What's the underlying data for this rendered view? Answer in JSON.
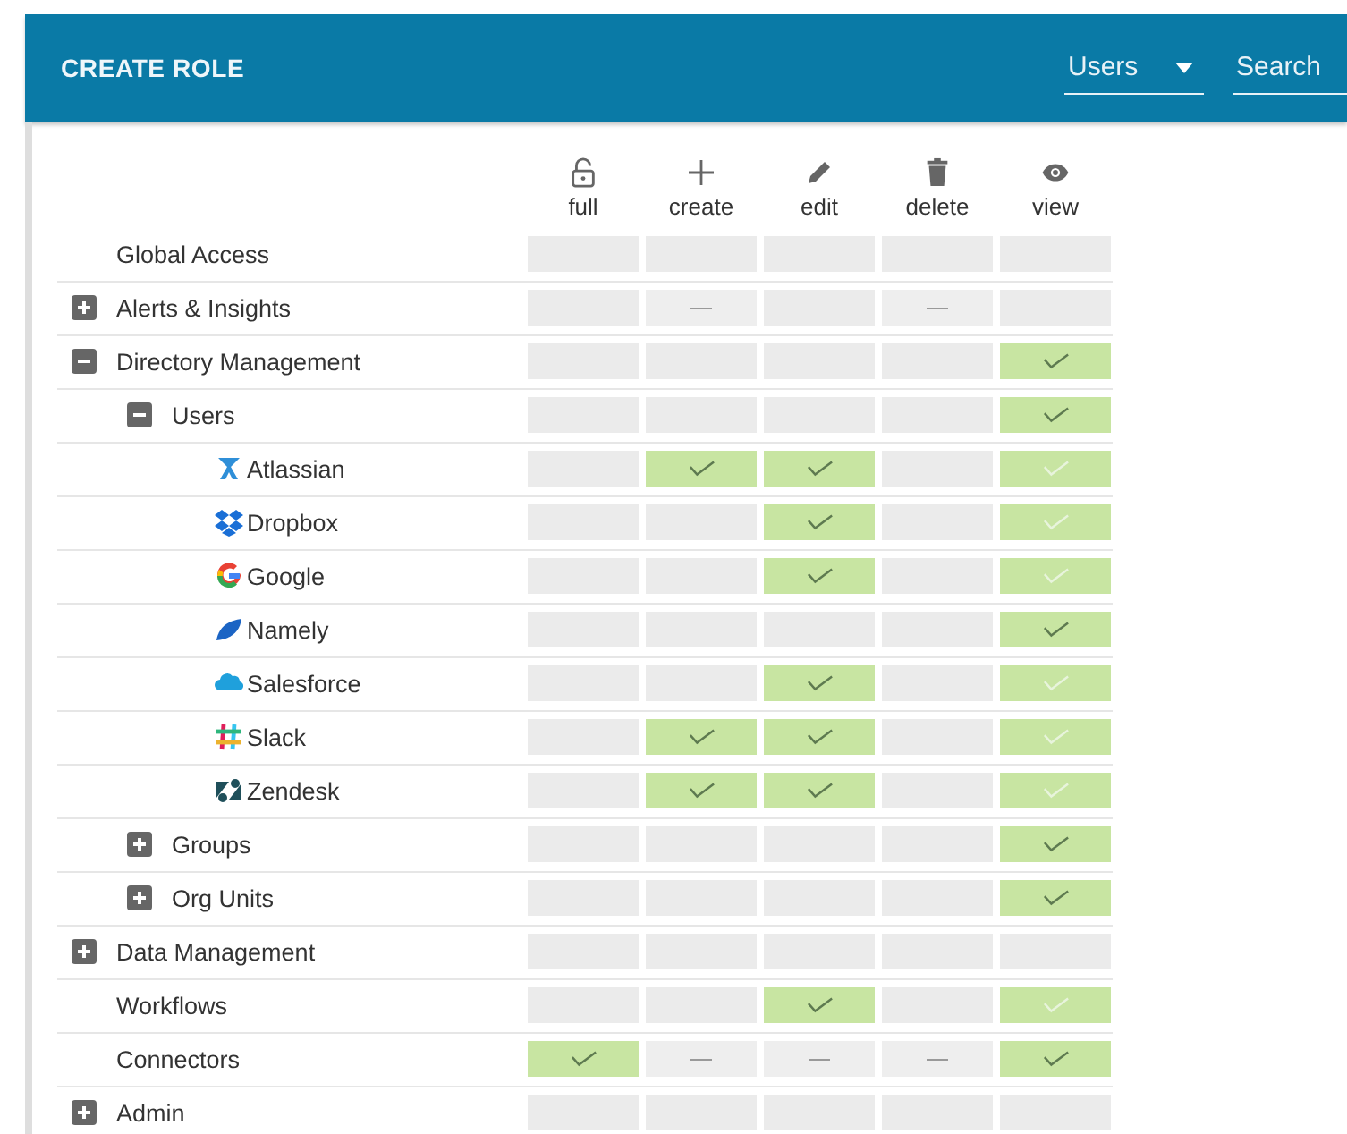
{
  "header": {
    "title": "CREATE ROLE",
    "filter": {
      "value": "Users"
    },
    "search": {
      "placeholder": "Search"
    }
  },
  "columns": [
    {
      "label": "full"
    },
    {
      "label": "create"
    },
    {
      "label": "edit"
    },
    {
      "label": "delete"
    },
    {
      "label": "view"
    }
  ],
  "rows": [
    {
      "label": "Global Access",
      "permissions": [
        {
          "checked": false,
          "inherited": false,
          "disabled": false
        },
        {
          "checked": false,
          "inherited": false,
          "disabled": false
        },
        {
          "checked": false,
          "inherited": false,
          "disabled": false
        },
        {
          "checked": false,
          "inherited": false,
          "disabled": false
        },
        {
          "checked": false,
          "inherited": false,
          "disabled": false
        }
      ]
    },
    {
      "label": "Alerts & Insights",
      "expanded": false,
      "permissions": [
        {
          "checked": false,
          "inherited": false,
          "disabled": false
        },
        {
          "checked": false,
          "inherited": false,
          "disabled": true
        },
        {
          "checked": false,
          "inherited": false,
          "disabled": false
        },
        {
          "checked": false,
          "inherited": false,
          "disabled": true
        },
        {
          "checked": false,
          "inherited": false,
          "disabled": false
        }
      ]
    },
    {
      "label": "Directory Management",
      "expanded": true,
      "permissions": [
        {
          "checked": false,
          "inherited": false,
          "disabled": false
        },
        {
          "checked": false,
          "inherited": false,
          "disabled": false
        },
        {
          "checked": false,
          "inherited": false,
          "disabled": false
        },
        {
          "checked": false,
          "inherited": false,
          "disabled": false
        },
        {
          "checked": true,
          "inherited": false,
          "disabled": false
        }
      ],
      "children": [
        {
          "label": "Users",
          "expanded": true,
          "permissions": [
            {
              "checked": false,
              "inherited": false,
              "disabled": false
            },
            {
              "checked": false,
              "inherited": false,
              "disabled": false
            },
            {
              "checked": false,
              "inherited": false,
              "disabled": false
            },
            {
              "checked": false,
              "inherited": false,
              "disabled": false
            },
            {
              "checked": true,
              "inherited": false,
              "disabled": false
            }
          ],
          "children": [
            {
              "label": "Atlassian",
              "kind": "app",
              "permissions": [
                {
                  "checked": false,
                  "inherited": false,
                  "disabled": false
                },
                {
                  "checked": true,
                  "inherited": false,
                  "disabled": false
                },
                {
                  "checked": true,
                  "inherited": false,
                  "disabled": false
                },
                {
                  "checked": false,
                  "inherited": false,
                  "disabled": false
                },
                {
                  "checked": true,
                  "inherited": true,
                  "disabled": false
                }
              ]
            },
            {
              "label": "Dropbox",
              "kind": "app",
              "permissions": [
                {
                  "checked": false,
                  "inherited": false,
                  "disabled": false
                },
                {
                  "checked": false,
                  "inherited": false,
                  "disabled": false
                },
                {
                  "checked": true,
                  "inherited": false,
                  "disabled": false
                },
                {
                  "checked": false,
                  "inherited": false,
                  "disabled": false
                },
                {
                  "checked": true,
                  "inherited": true,
                  "disabled": false
                }
              ]
            },
            {
              "label": "Google",
              "kind": "app",
              "permissions": [
                {
                  "checked": false,
                  "inherited": false,
                  "disabled": false
                },
                {
                  "checked": false,
                  "inherited": false,
                  "disabled": false
                },
                {
                  "checked": true,
                  "inherited": false,
                  "disabled": false
                },
                {
                  "checked": false,
                  "inherited": false,
                  "disabled": false
                },
                {
                  "checked": true,
                  "inherited": true,
                  "disabled": false
                }
              ]
            },
            {
              "label": "Namely",
              "kind": "app",
              "permissions": [
                {
                  "checked": false,
                  "inherited": false,
                  "disabled": false
                },
                {
                  "checked": false,
                  "inherited": false,
                  "disabled": false
                },
                {
                  "checked": false,
                  "inherited": false,
                  "disabled": false
                },
                {
                  "checked": false,
                  "inherited": false,
                  "disabled": false
                },
                {
                  "checked": true,
                  "inherited": false,
                  "disabled": false
                }
              ]
            },
            {
              "label": "Salesforce",
              "kind": "app",
              "permissions": [
                {
                  "checked": false,
                  "inherited": false,
                  "disabled": false
                },
                {
                  "checked": false,
                  "inherited": false,
                  "disabled": false
                },
                {
                  "checked": true,
                  "inherited": false,
                  "disabled": false
                },
                {
                  "checked": false,
                  "inherited": false,
                  "disabled": false
                },
                {
                  "checked": true,
                  "inherited": true,
                  "disabled": false
                }
              ]
            },
            {
              "label": "Slack",
              "kind": "app",
              "permissions": [
                {
                  "checked": false,
                  "inherited": false,
                  "disabled": false
                },
                {
                  "checked": true,
                  "inherited": false,
                  "disabled": false
                },
                {
                  "checked": true,
                  "inherited": false,
                  "disabled": false
                },
                {
                  "checked": false,
                  "inherited": false,
                  "disabled": false
                },
                {
                  "checked": true,
                  "inherited": true,
                  "disabled": false
                }
              ]
            },
            {
              "label": "Zendesk",
              "kind": "app",
              "permissions": [
                {
                  "checked": false,
                  "inherited": false,
                  "disabled": false
                },
                {
                  "checked": true,
                  "inherited": false,
                  "disabled": false
                },
                {
                  "checked": true,
                  "inherited": false,
                  "disabled": false
                },
                {
                  "checked": false,
                  "inherited": false,
                  "disabled": false
                },
                {
                  "checked": true,
                  "inherited": true,
                  "disabled": false
                }
              ]
            }
          ]
        },
        {
          "label": "Groups",
          "expanded": false,
          "permissions": [
            {
              "checked": false,
              "inherited": false,
              "disabled": false
            },
            {
              "checked": false,
              "inherited": false,
              "disabled": false
            },
            {
              "checked": false,
              "inherited": false,
              "disabled": false
            },
            {
              "checked": false,
              "inherited": false,
              "disabled": false
            },
            {
              "checked": true,
              "inherited": false,
              "disabled": false
            }
          ]
        },
        {
          "label": "Org Units",
          "expanded": false,
          "permissions": [
            {
              "checked": false,
              "inherited": false,
              "disabled": false
            },
            {
              "checked": false,
              "inherited": false,
              "disabled": false
            },
            {
              "checked": false,
              "inherited": false,
              "disabled": false
            },
            {
              "checked": false,
              "inherited": false,
              "disabled": false
            },
            {
              "checked": true,
              "inherited": false,
              "disabled": false
            }
          ]
        }
      ]
    },
    {
      "label": "Data Management",
      "expanded": false,
      "permissions": [
        {
          "checked": false,
          "inherited": false,
          "disabled": false
        },
        {
          "checked": false,
          "inherited": false,
          "disabled": false
        },
        {
          "checked": false,
          "inherited": false,
          "disabled": false
        },
        {
          "checked": false,
          "inherited": false,
          "disabled": false
        },
        {
          "checked": false,
          "inherited": false,
          "disabled": false
        }
      ]
    },
    {
      "label": "Workflows",
      "permissions": [
        {
          "checked": false,
          "inherited": false,
          "disabled": false
        },
        {
          "checked": false,
          "inherited": false,
          "disabled": false
        },
        {
          "checked": true,
          "inherited": false,
          "disabled": false
        },
        {
          "checked": false,
          "inherited": false,
          "disabled": false
        },
        {
          "checked": true,
          "inherited": true,
          "disabled": false
        }
      ]
    },
    {
      "label": "Connectors",
      "permissions": [
        {
          "checked": true,
          "inherited": false,
          "disabled": false
        },
        {
          "checked": false,
          "inherited": false,
          "disabled": true
        },
        {
          "checked": false,
          "inherited": false,
          "disabled": true
        },
        {
          "checked": false,
          "inherited": false,
          "disabled": true
        },
        {
          "checked": true,
          "inherited": false,
          "disabled": false
        }
      ]
    },
    {
      "label": "Admin",
      "expanded": false,
      "permissions": [
        {
          "checked": false,
          "inherited": false,
          "disabled": false
        },
        {
          "checked": false,
          "inherited": false,
          "disabled": false
        },
        {
          "checked": false,
          "inherited": false,
          "disabled": false
        },
        {
          "checked": false,
          "inherited": false,
          "disabled": false
        },
        {
          "checked": false,
          "inherited": false,
          "disabled": false
        }
      ]
    }
  ]
}
